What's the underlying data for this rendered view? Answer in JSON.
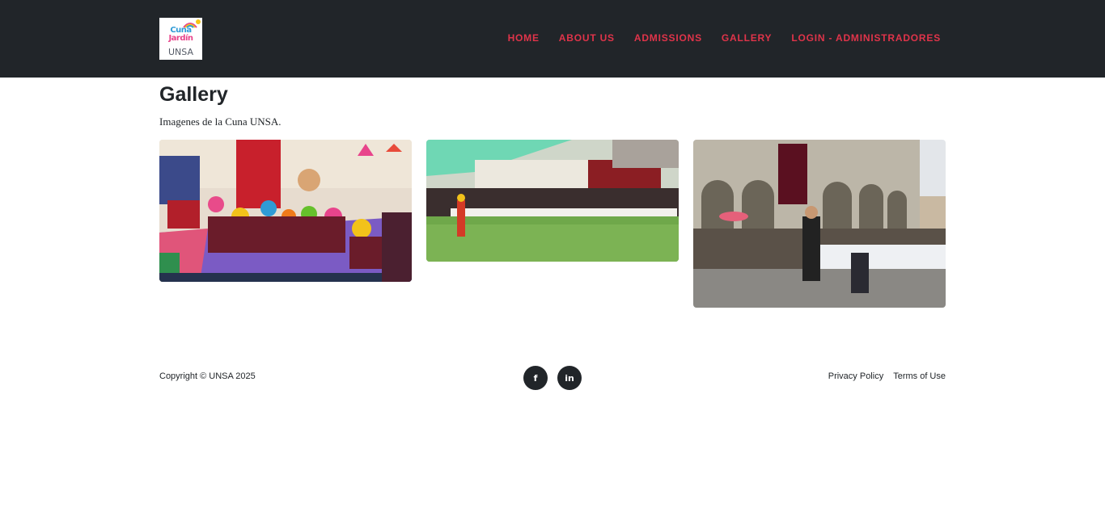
{
  "header": {
    "logo": {
      "line1": "Cuna",
      "line1b": "Jardín",
      "line2": "UNSA",
      "colors": [
        "#2f9bd6",
        "#e8448b",
        "#f5c518",
        "#555b66"
      ]
    },
    "nav": [
      {
        "label": "Home"
      },
      {
        "label": "About Us"
      },
      {
        "label": "Admissions"
      },
      {
        "label": "Gallery"
      },
      {
        "label": "Login - Administradores"
      }
    ],
    "background": "#212529",
    "accent": "#e0344a"
  },
  "main": {
    "title": "Gallery",
    "subtitle": "Imagenes de la Cuna UNSA.",
    "images": [
      {
        "icon": "photo-classroom-clowns"
      },
      {
        "icon": "photo-courtyard-event"
      },
      {
        "icon": "photo-parade-plaza"
      }
    ]
  },
  "footer": {
    "copyright": "Copyright © UNSA 2025",
    "social": [
      {
        "icon": "facebook-icon",
        "glyph": "f"
      },
      {
        "icon": "linkedin-icon",
        "glyph": "in"
      }
    ],
    "links": [
      {
        "label": "Privacy Policy"
      },
      {
        "label": "Terms of Use"
      }
    ]
  }
}
